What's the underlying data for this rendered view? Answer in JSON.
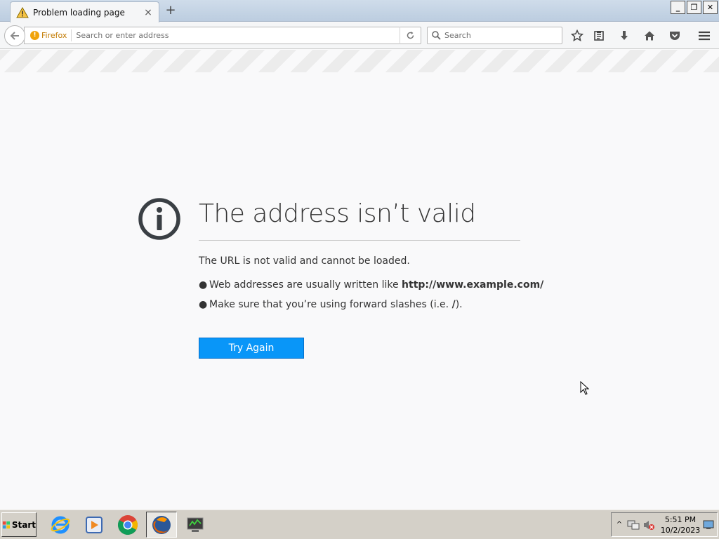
{
  "tab": {
    "title": "Problem loading page",
    "close_glyph": "×",
    "icon": "warning-icon"
  },
  "newtab_glyph": "+",
  "window_buttons": {
    "minimize": "_",
    "restore": "❐",
    "close": "✕"
  },
  "urlbar": {
    "identity_label": "Firefox",
    "placeholder": "Search or enter address",
    "value": ""
  },
  "searchbar": {
    "placeholder": "Search"
  },
  "toolbar_icons": [
    "bookmark-star-icon",
    "reading-list-icon",
    "downloads-icon",
    "home-icon",
    "pocket-icon",
    "menu-icon"
  ],
  "error_page": {
    "title": "The address isn’t valid",
    "description": "The URL is not valid and cannot be loaded.",
    "bullets": [
      {
        "prefix": "Web addresses are usually written like ",
        "bold": "http://www.example.com/",
        "suffix": ""
      },
      {
        "prefix": "Make sure that you’re using forward slashes (i.e. ",
        "bold": "/",
        "suffix": ")."
      }
    ],
    "button_label": "Try Again",
    "accent_color": "#0996f8"
  },
  "taskbar": {
    "start_label": "Start",
    "apps": [
      "ie-icon",
      "media-player-icon",
      "chrome-icon",
      "firefox-icon",
      "network-monitor-icon"
    ],
    "clock_time": "5:51 PM",
    "clock_date": "10/2/2023"
  }
}
